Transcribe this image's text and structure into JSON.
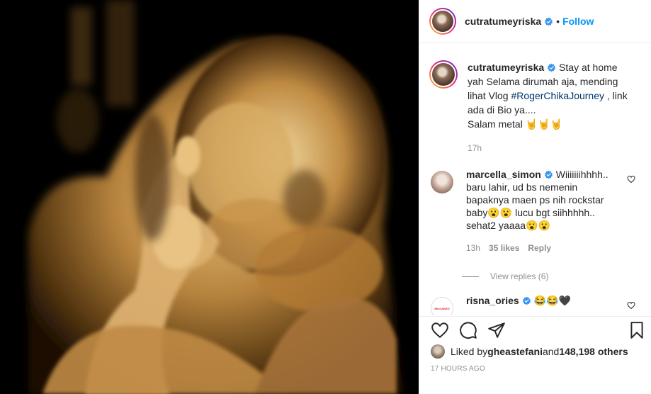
{
  "post": {
    "username": "cutratumeyriska",
    "separator": "•",
    "follow_label": "Follow",
    "image_label": "3D ultrasound image"
  },
  "caption": {
    "username": "cutratumeyriska",
    "text_before": " Stay at home yah Selama dirumah aja, mending lihat Vlog ",
    "hashtag": "#RogerChikaJourney",
    "text_after": " , link ada di Bio ya....",
    "line2": "Salam metal 🤘🤘🤘",
    "time": "17h"
  },
  "comments": [
    {
      "username": "marcella_simon",
      "text": " Wiiiiiiihhhh.. baru lahir, ud bs nemenin bapaknya maen ps nih rockstar baby😮😮 lucu bgt siihhhhh.. sehat2 yaaaa😮😮",
      "time": "13h",
      "likes": "35 likes",
      "reply_label": "Reply",
      "view_replies": "View replies (6)"
    },
    {
      "username": "risna_ories",
      "text": " 😂😂🖤",
      "avatar_text": "MILGANZO"
    }
  ],
  "likes_bar": {
    "prefix": "Liked by ",
    "user": "gheastefani",
    "middle": " and ",
    "others": "148,198 others"
  },
  "timestamp": "17 HOURS AGO",
  "colors": {
    "accent": "#0095f6",
    "hashtag": "#00376b",
    "muted": "#8e8e8e",
    "ultrasound": "#c99a4f"
  },
  "icons": {
    "like": "heart-icon",
    "comment": "comment-bubble-icon",
    "share": "paper-plane-icon",
    "save": "bookmark-icon",
    "verified": "verified-badge-icon"
  }
}
